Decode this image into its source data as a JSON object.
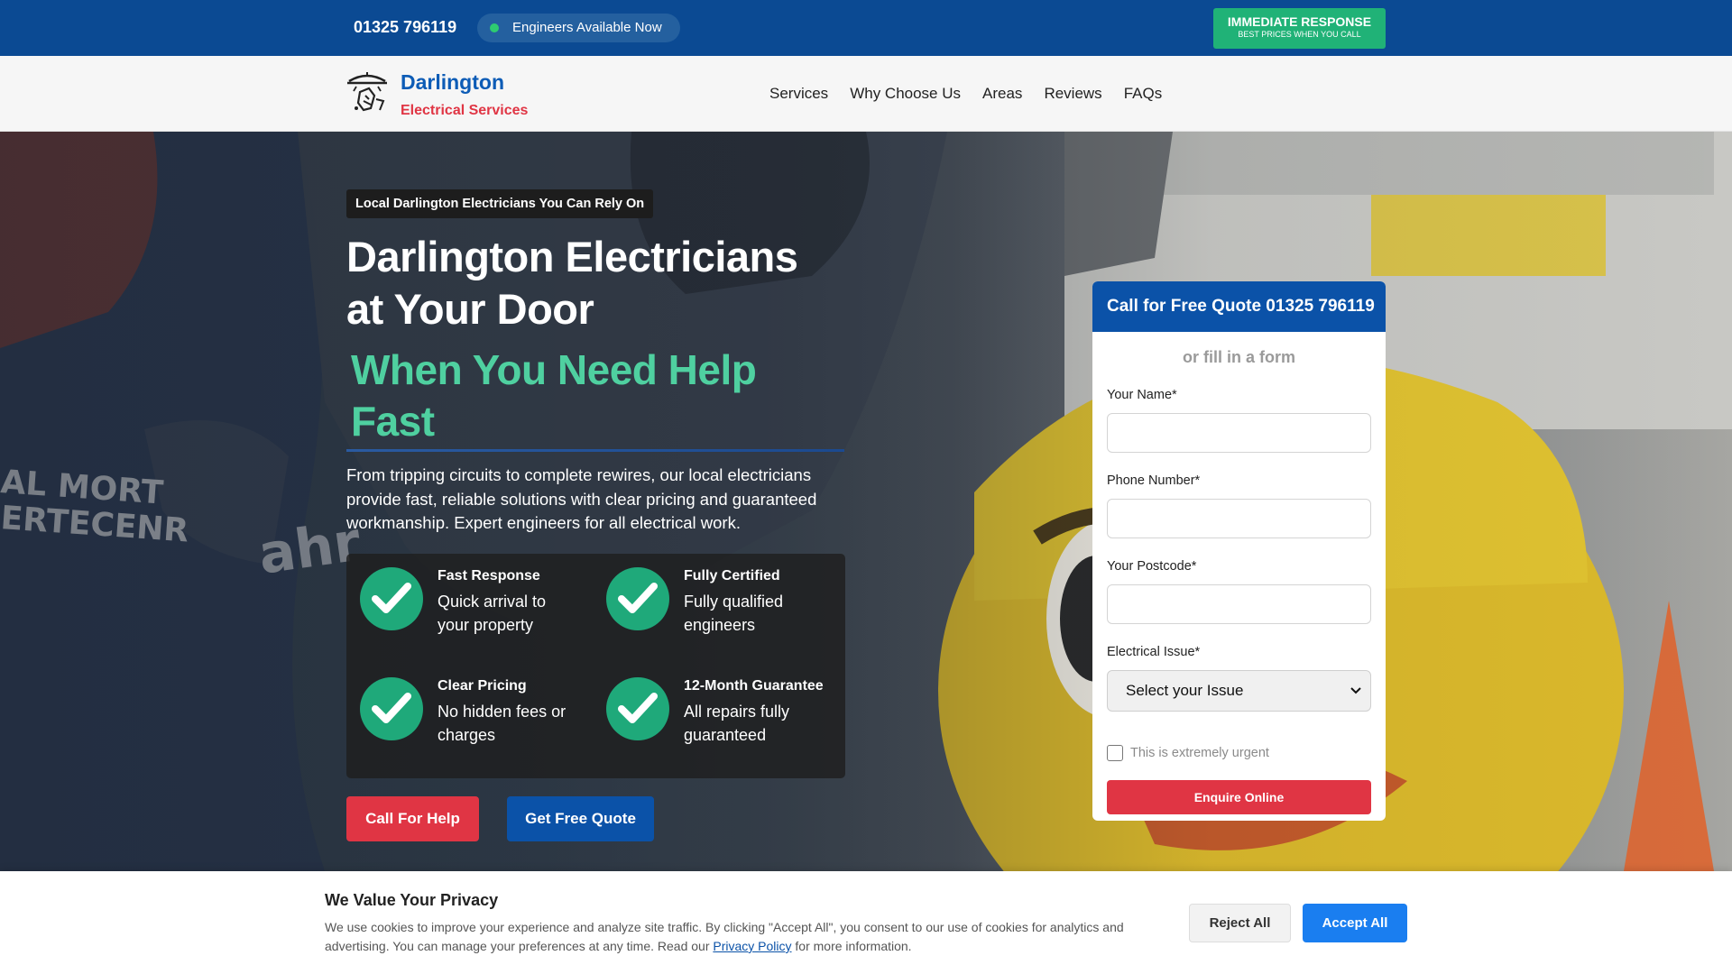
{
  "topbar": {
    "phone": "01325 796119",
    "availability": "Engineers Available Now",
    "cta_title": "IMMEDIATE RESPONSE",
    "cta_sub": "BEST PRICES WHEN YOU CALL"
  },
  "header": {
    "brand_line1": "Darlington",
    "brand_line2": "Electrical Services",
    "nav": [
      "Services",
      "Why Choose Us",
      "Areas",
      "Reviews",
      "FAQs"
    ]
  },
  "hero": {
    "tag": "Local Darlington Electricians You Can Rely On",
    "title_line1": "Darlington Electricians",
    "title_line2": "at Your Door",
    "subtitle_line1": "When You Need Help",
    "subtitle_line2": "Fast",
    "lead": "From tripping circuits to complete rewires, our local electricians provide fast, reliable solutions with clear pricing and guaranteed workmanship. Expert engineers for all electrical work.",
    "features": [
      {
        "title": "Fast Response",
        "desc": "Quick arrival to your property"
      },
      {
        "title": "Fully Certified",
        "desc": "Fully qualified engineers"
      },
      {
        "title": "Clear Pricing",
        "desc": "No hidden fees or charges"
      },
      {
        "title": "12-Month Guarantee",
        "desc": "All repairs fully guaranteed"
      }
    ],
    "btn_help": "Call For Help",
    "btn_quote": "Get Free Quote"
  },
  "form": {
    "heading": "Call for Free Quote 01325 796119",
    "sub": "or fill in a form",
    "name_label": "Your Name*",
    "phone_label": "Phone Number*",
    "postcode_label": "Your Postcode*",
    "issue_label": "Electrical Issue*",
    "issue_selected": "Select your Issue",
    "urgent_label": "This is extremely urgent",
    "submit": "Enquire Online"
  },
  "cookie": {
    "title": "We Value Your Privacy",
    "text_before": "We use cookies to improve your experience and analyze site traffic. By clicking \"Accept All\", you consent to our use of cookies for analytics and advertising. You can manage your preferences at any time. Read our ",
    "link": "Privacy Policy",
    "text_after": " for more information.",
    "reject": "Reject All",
    "accept": "Accept All"
  },
  "colors": {
    "topbar": "#0b4a93",
    "accent_green": "#20b277",
    "brand_blue": "#0d5cb6",
    "brand_red": "#e03544",
    "subtitle_green": "#4fd0a0"
  }
}
